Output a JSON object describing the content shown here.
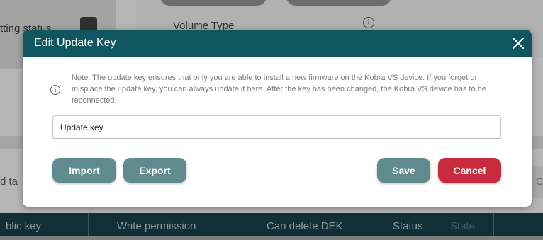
{
  "background": {
    "setting_status_label": "tting status",
    "volume_type_label": "Volume Type",
    "info_icon_char": "i",
    "left_side_text": "d ta",
    "right_side_text": "C",
    "table_headers": [
      "blic key",
      "Write permission",
      "Can delete DEK",
      "Status",
      "State"
    ]
  },
  "dialog": {
    "title": "Edit Update Key",
    "close_icon": "close-icon",
    "note": "Note: The update key ensures that only you are able to install a new firmware on the Kobra VS device. If you forget or misplace the update key, you can always update it here. After the key has been changed, the Kobra VS device has to be reconnected.",
    "note_icon_char": "i",
    "input": {
      "value": "Update key",
      "placeholder": ""
    },
    "buttons": {
      "import": "Import",
      "export": "Export",
      "save": "Save",
      "cancel": "Cancel"
    }
  },
  "colors": {
    "header_bg": "#0f5660",
    "primary_button": "#5f8a8e",
    "cancel_button": "#c92b3e",
    "table_header_bg": "#122f37"
  }
}
